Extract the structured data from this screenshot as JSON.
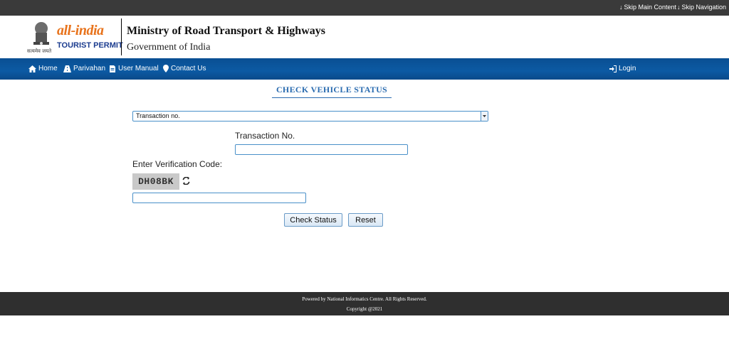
{
  "topbar": {
    "skip_main": "Skip Main Content",
    "skip_nav": "Skip Navigation"
  },
  "header": {
    "logo_text": "all-india",
    "logo_sub": "TOURIST PERMIT",
    "emblem_motto": "सत्यमेव जयते",
    "ministry": "Ministry of Road Transport & Highways",
    "government": "Government of India"
  },
  "nav": {
    "home": "Home",
    "parivahan": "Parivahan",
    "user_manual": "User Manual",
    "contact_us": "Contact Us",
    "login": "Login"
  },
  "form": {
    "title": "CHECK VEHICLE STATUS",
    "search_type_selected": "Transaction no.",
    "transaction_label": "Transaction No.",
    "transaction_value": "",
    "verification_label": "Enter Verification Code:",
    "captcha_text": "DH08BK",
    "captcha_value": "",
    "check_status_label": "Check Status",
    "reset_label": "Reset"
  },
  "footer": {
    "powered_by": "Powered by National Informatics Centre. All Rights Reserved.",
    "copyright": "Copyright @2021"
  },
  "colors": {
    "nav_blue": "#0c5aa3",
    "title_blue": "#2b6cb0",
    "topbar": "#3a3a3a",
    "footer": "#2f2f2f"
  }
}
